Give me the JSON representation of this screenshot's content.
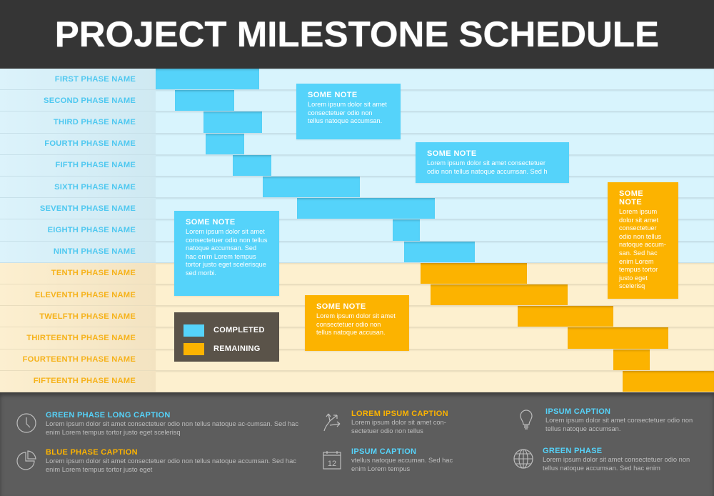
{
  "header": {
    "title": "PROJECT MILESTONE SCHEDULE"
  },
  "colors": {
    "completed": "#55d3fa",
    "remaining": "#fcb300",
    "blue_row_bg": "#d8f4fd",
    "orange_row_bg": "#fdf0cf",
    "legend_bg": "#5a5349",
    "header_bg": "#353535",
    "footer_bg": "#5d5d5d"
  },
  "chart_data": {
    "type": "gantt",
    "title": "PROJECT MILESTONE SCHEDULE",
    "x_unit": "percent of timeline",
    "xlim": [
      0,
      100
    ],
    "legend": [
      {
        "label": "COMPLETED",
        "status": "completed"
      },
      {
        "label": "REMAINING",
        "status": "remaining"
      }
    ],
    "legend_position": "bottom-left",
    "phases": [
      {
        "name": "FIRST PHASE NAME",
        "start": 0.0,
        "end": 18.5,
        "status": "completed"
      },
      {
        "name": "SECOND PHASE NAME",
        "start": 3.5,
        "end": 14.1,
        "status": "completed"
      },
      {
        "name": "THIRD PHASE NAME",
        "start": 8.6,
        "end": 19.1,
        "status": "completed"
      },
      {
        "name": "FOURTH PHASE NAME",
        "start": 9.0,
        "end": 15.9,
        "status": "completed"
      },
      {
        "name": "FIFTH PHASE NAME",
        "start": 13.8,
        "end": 20.7,
        "status": "completed"
      },
      {
        "name": "SIXTH PHASE NAME",
        "start": 19.2,
        "end": 36.6,
        "status": "completed"
      },
      {
        "name": "SEVENTH PHASE NAME",
        "start": 25.3,
        "end": 50.0,
        "status": "completed"
      },
      {
        "name": "EIGHTH PHASE NAME",
        "start": 42.5,
        "end": 47.3,
        "status": "completed"
      },
      {
        "name": "NINTH PHASE NAME",
        "start": 44.5,
        "end": 57.2,
        "status": "completed"
      },
      {
        "name": "TENTH PHASE NAME",
        "start": 47.4,
        "end": 66.5,
        "status": "remaining"
      },
      {
        "name": "ELEVENTH PHASE NAME",
        "start": 49.2,
        "end": 73.8,
        "status": "remaining"
      },
      {
        "name": "TWELFTH PHASE NAME",
        "start": 64.8,
        "end": 82.0,
        "status": "remaining"
      },
      {
        "name": "THIRTEENTH PHASE NAME",
        "start": 73.8,
        "end": 91.8,
        "status": "remaining"
      },
      {
        "name": "FOURTEENTH PHASE NAME",
        "start": 82.0,
        "end": 88.5,
        "status": "remaining"
      },
      {
        "name": "FIFTEENTH PHASE NAME",
        "start": 83.6,
        "end": 100.0,
        "status": "remaining"
      }
    ],
    "annotations": [
      {
        "id": "note-1",
        "title": "SOME NOTE",
        "text": "Lorem ipsum dolor sit amet consectetuer odio non tellus natoque accumsan.",
        "color": "completed"
      },
      {
        "id": "note-2",
        "title": "SOME NOTE",
        "text": "Lorem ipsum dolor sit amet consectetuer odio non tellus natoque accumsan. Sed h",
        "color": "completed"
      },
      {
        "id": "note-3",
        "title": "SOME NOTE",
        "text": "Lorem ipsum dolor sit amet consectetuer odio non tellus natoque accum-san. Sed hac enim Lorem tempus tortor justo eget scelerisq",
        "color": "remaining"
      },
      {
        "id": "note-4",
        "title": "SOME NOTE",
        "text": "Lorem ipsum dolor sit amet consectetuer odio non tellus natoque accumsan. Sed hac enim Lorem tempus tortor justo eget scelerisque sed morbi.",
        "color": "completed"
      },
      {
        "id": "note-5",
        "title": "SOME NOTE",
        "text": "Lorem ipsum dolor sit amet consectetuer odio non tellus natoque accusan.",
        "color": "remaining"
      }
    ]
  },
  "footer": {
    "items": [
      {
        "icon": "clock-icon",
        "title": "GREEN PHASE LONG CAPTION",
        "title_color": "#55d3fa",
        "text": "Lorem ipsum dolor sit amet consectetuer odio non tellus natoque ac-cumsan. Sed hac enim Lorem tempus tortor justo eget scelerisq"
      },
      {
        "icon": "pie-chart-icon",
        "title": "BLUE PHASE CAPTION",
        "title_color": "#fcb300",
        "text": "Lorem ipsum dolor sit amet consectetuer odio non tellus natoque accumsan. Sed hac enim Lorem tempus tortor justo eget"
      },
      {
        "icon": "diverging-arrows-icon",
        "title": "LOREM IPSUM CAPTION",
        "title_color": "#fcb300",
        "text": "Lorem ipsum dolor sit amet con-sectetuer odio non tellus"
      },
      {
        "icon": "calendar-icon",
        "icon_text": "12",
        "title": "IPSUM CAPTION",
        "title_color": "#55d3fa",
        "text": "vtellus natoque accuman. Sed hac enim Lorem tempus"
      },
      {
        "icon": "lightbulb-icon",
        "title": "IPSUM CAPTION",
        "title_color": "#55d3fa",
        "text": "Lorem ipsum dolor sit amet consectetuer odio non tellus natoque accumsan."
      },
      {
        "icon": "globe-icon",
        "title": "GREEN PHASE",
        "title_color": "#55d3fa",
        "text": "Lorem ipsum dolor sit amet consectetuer odio non tellus natoque accumsan. Sed hac enim"
      }
    ]
  }
}
